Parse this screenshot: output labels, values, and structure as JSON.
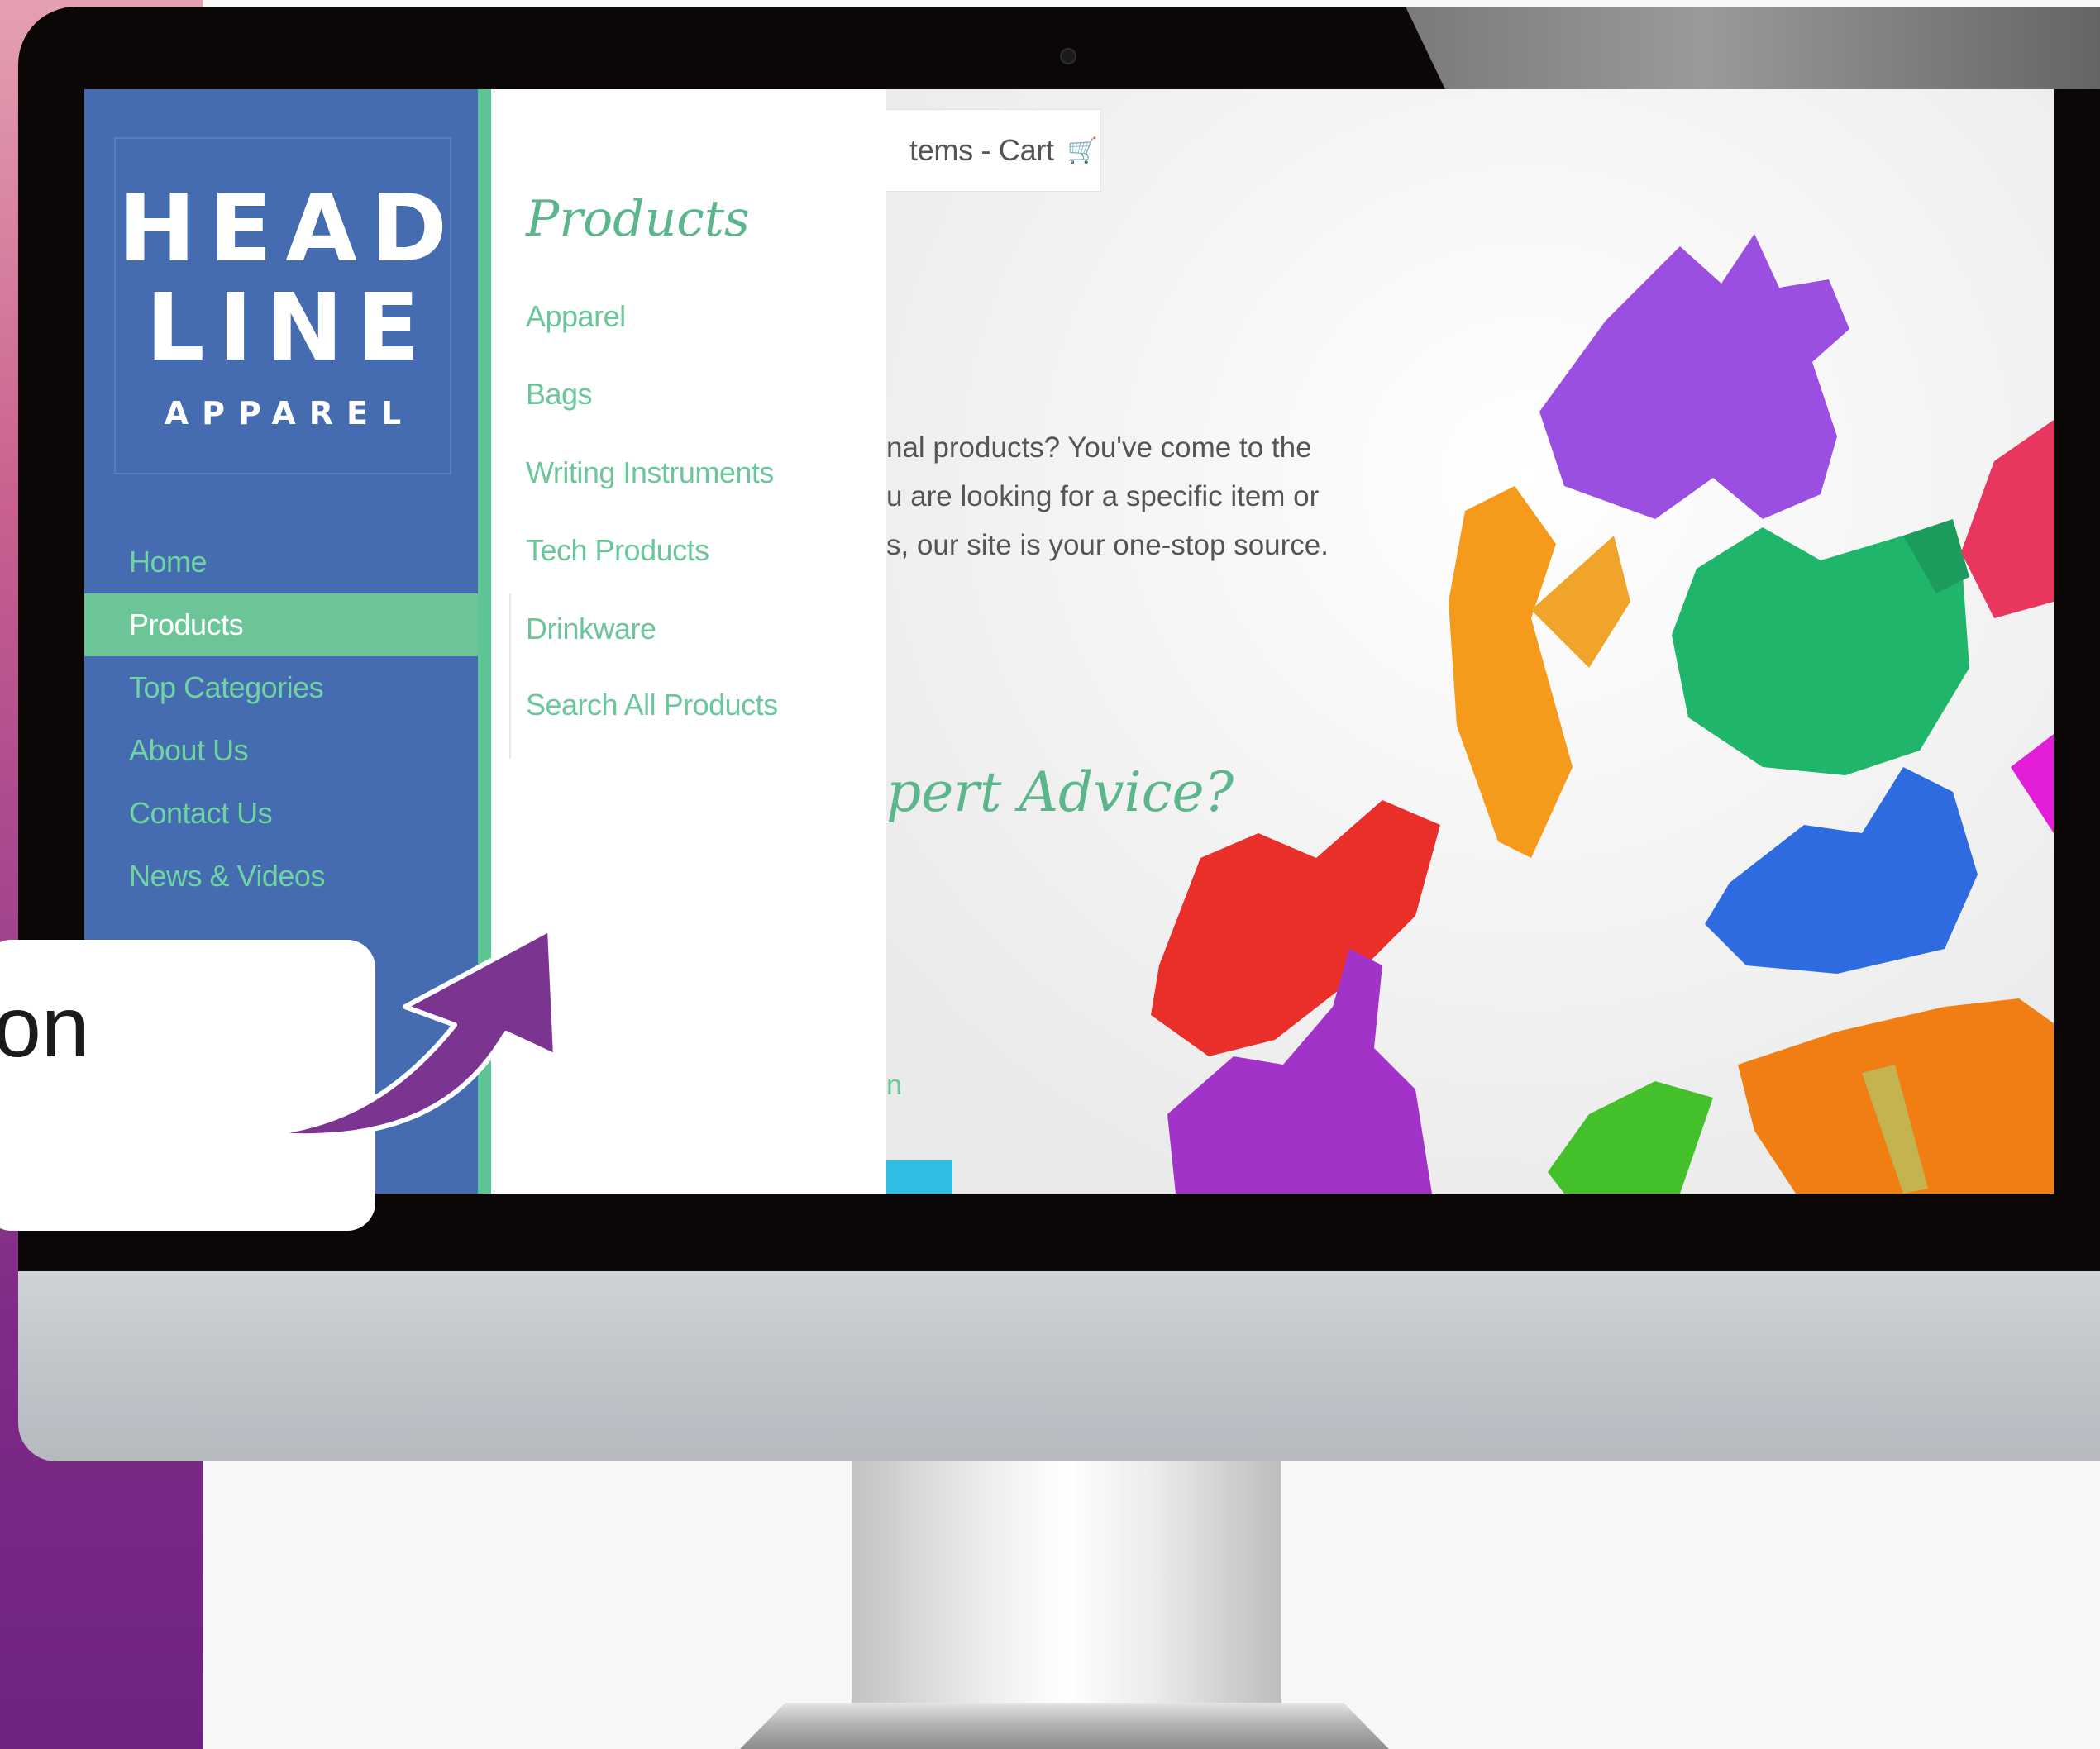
{
  "callout": {
    "text": "on"
  },
  "logo": {
    "line1": "HEAD",
    "line2": "LINE",
    "line3": "APPAREL"
  },
  "sidebar": {
    "items": [
      {
        "label": "Home",
        "active": false
      },
      {
        "label": "Products",
        "active": true
      },
      {
        "label": "Top Categories",
        "active": false
      },
      {
        "label": "About Us",
        "active": false
      },
      {
        "label": "Contact Us",
        "active": false
      },
      {
        "label": "News & Videos",
        "active": false
      }
    ]
  },
  "dropdown": {
    "title": "Products",
    "items": [
      "Apparel",
      "Bags",
      "Writing Instruments",
      "Tech Products",
      "Drinkware",
      "Search All Products"
    ]
  },
  "header": {
    "cart_label": "tems - Cart",
    "cart_icon": "shopping-cart-icon"
  },
  "content": {
    "intro_lines": [
      "nal products? You've come to the",
      "u are looking for a specific item or",
      "s, our site is your one-stop source."
    ],
    "heading": "pert Advice?",
    "fragment": "n"
  },
  "colors": {
    "sidebar_bg": "#456bb0",
    "accent_green": "#6cc597",
    "link_green": "#6bc79a",
    "callout_arrow": "#7b3590"
  }
}
